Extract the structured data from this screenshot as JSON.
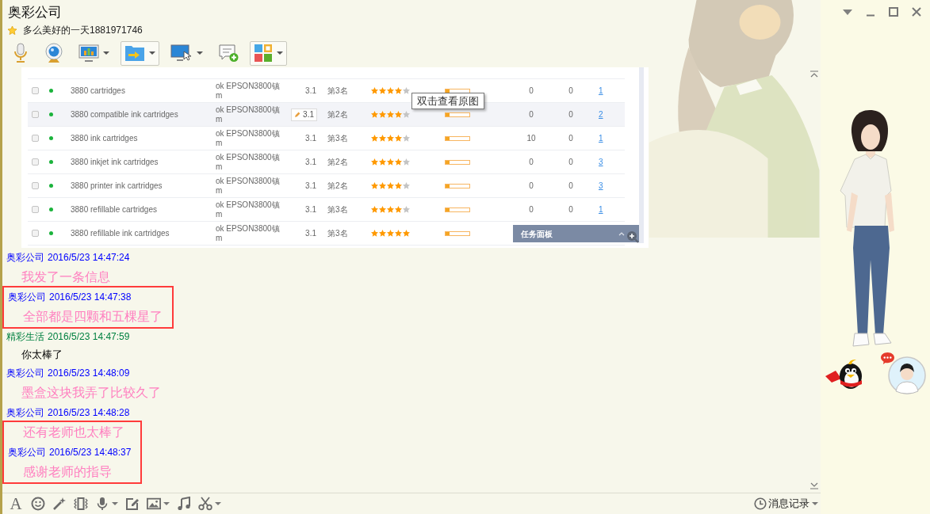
{
  "window": {
    "title": "奥彩公司",
    "signature": "多么美好的一天1881971746"
  },
  "toolbar": [
    {
      "menu": false,
      "selected": false
    },
    {
      "menu": false,
      "selected": false
    },
    {
      "menu": true,
      "selected": false
    },
    {
      "menu": true,
      "selected": true
    },
    {
      "menu": true,
      "selected": false
    },
    {
      "menu": false,
      "selected": false
    },
    {
      "menu": true,
      "selected": true
    }
  ],
  "chat": {
    "lines": [
      {
        "kind": "image",
        "tooltip": "双击查看原图",
        "panel_title": "任务面板",
        "rows": [
          {
            "checked": false,
            "color": "#1bb33c",
            "column_3": "3880 cartridges",
            "column_4": "ok EPSON3800镇m",
            "column_5": "3.1",
            "column_6": "第3名",
            "stars": 4,
            "level": 0.18,
            "column_9": "0",
            "column_10": "0",
            "column_11": "1",
            "hovered": false
          },
          {
            "checked": false,
            "color": "#1bb33c",
            "column_3": "3880 compatible ink cartridges",
            "column_4": "ok EPSON3800镇m",
            "column_5": "3.1",
            "column_6": "第2名",
            "stars": 4,
            "level": 0.18,
            "column_9": "0",
            "column_10": "0",
            "column_11": "2",
            "hovered": true
          },
          {
            "checked": false,
            "color": "#1bb33c",
            "column_3": "3880 ink cartridges",
            "column_4": "ok EPSON3800镇m",
            "column_5": "3.1",
            "column_6": "第3名",
            "stars": 4,
            "level": 0.18,
            "column_9": "10",
            "column_10": "0",
            "column_11": "1",
            "hovered": false
          },
          {
            "checked": false,
            "color": "#1bb33c",
            "column_3": "3880 inkjet ink cartridges",
            "column_4": "ok EPSON3800镇m",
            "column_5": "3.1",
            "column_6": "第2名",
            "stars": 4,
            "level": 0.18,
            "column_9": "0",
            "column_10": "0",
            "column_11": "3",
            "hovered": false
          },
          {
            "checked": false,
            "color": "#1bb33c",
            "column_3": "3880 printer ink cartridges",
            "column_4": "ok EPSON3800镇m",
            "column_5": "3.1",
            "column_6": "第2名",
            "stars": 4,
            "level": 0.18,
            "column_9": "0",
            "column_10": "0",
            "column_11": "3",
            "hovered": false
          },
          {
            "checked": false,
            "color": "#1bb33c",
            "column_3": "3880 refillable cartridges",
            "column_4": "ok EPSON3800镇m",
            "column_5": "3.1",
            "column_6": "第3名",
            "stars": 4,
            "level": 0.18,
            "column_9": "0",
            "column_10": "0",
            "column_11": "1",
            "hovered": false
          },
          {
            "checked": false,
            "color": "#1bb33c",
            "column_3": "3880 refillable ink cartridges",
            "column_4": "ok EPSON3800镇m",
            "column_5": "3.1",
            "column_6": "第3名",
            "stars": 5,
            "level": 0.18,
            "hovered": false
          }
        ]
      },
      {
        "kind": "header",
        "sender": "奥彩公司",
        "time": "2016/5/23 14:47:24",
        "outgoing": true
      },
      {
        "kind": "text",
        "text": "我发了一条信息",
        "outgoing": true
      },
      {
        "kind": "highlight",
        "lines": [
          {
            "kind": "header",
            "sender": "奥彩公司",
            "time": "2016/5/23 14:47:38",
            "outgoing": true
          },
          {
            "kind": "text",
            "text": "全部都是四颗和五棵星了",
            "outgoing": true
          }
        ]
      },
      {
        "kind": "header",
        "sender": "精彩生活",
        "time": "2016/5/23 14:47:59",
        "outgoing": false
      },
      {
        "kind": "text",
        "text": "你太棒了",
        "outgoing": false
      },
      {
        "kind": "header",
        "sender": "奥彩公司",
        "time": "2016/5/23 14:48:09",
        "outgoing": true
      },
      {
        "kind": "text",
        "text": "墨盒这块我弄了比较久了",
        "outgoing": true
      },
      {
        "kind": "header",
        "sender": "奥彩公司",
        "time": "2016/5/23 14:48:28",
        "outgoing": true
      },
      {
        "kind": "highlight",
        "lines": [
          {
            "kind": "text",
            "text": "还有老师也太棒了",
            "outgoing": true
          },
          {
            "kind": "header",
            "sender": "奥彩公司",
            "time": "2016/5/23 14:48:37",
            "outgoing": true
          },
          {
            "kind": "text",
            "text": "感谢老师的指导",
            "outgoing": true
          }
        ]
      }
    ]
  },
  "input_toolbar": {
    "font_label": "A",
    "tools": [
      {
        "menu": false
      },
      {
        "menu": false
      },
      {
        "menu": false
      },
      {
        "menu": true
      },
      {
        "menu": false
      },
      {
        "menu": true
      },
      {
        "menu": false
      },
      {
        "menu": true
      }
    ]
  },
  "history_button": {
    "label": "消息记录"
  }
}
